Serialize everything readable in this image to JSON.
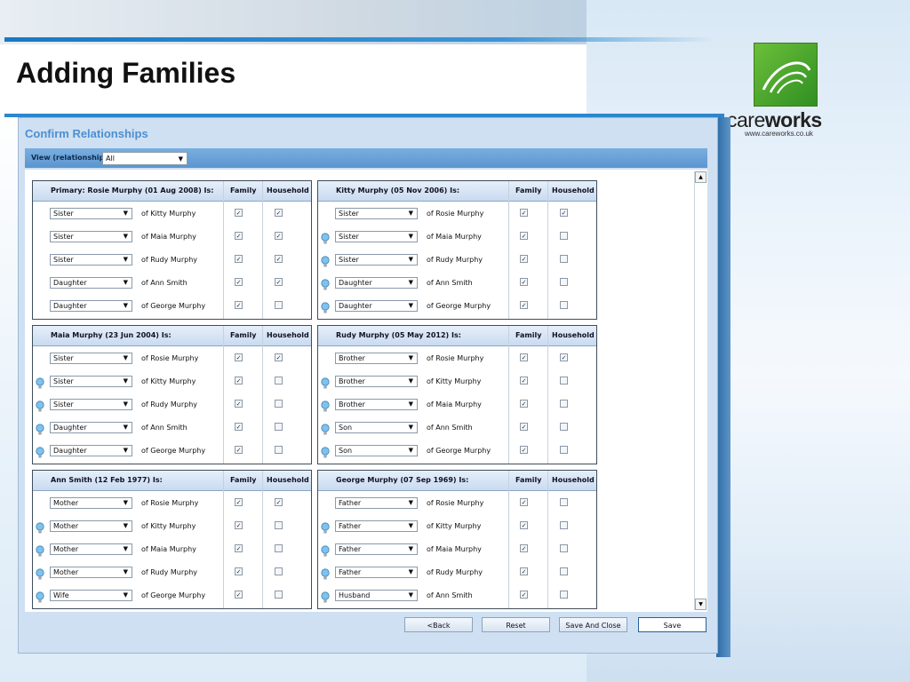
{
  "slide": {
    "title": "Adding Families",
    "brand_light": "care",
    "brand_bold": "works",
    "brand_url": "www.careworks.co.uk",
    "accent": "#2c87cc",
    "logo_color": "#4ea82a"
  },
  "dialog": {
    "title": "Confirm Relationships",
    "filter_label": "View (relationship)",
    "filter_value": "All"
  },
  "columns": {
    "family": "Family",
    "household": "Household"
  },
  "panels": [
    {
      "heading": "Primary: Rosie Murphy (01 Aug 2008) Is:",
      "rows": [
        {
          "rel": "Sister",
          "of": "of Kitty Murphy",
          "family": true,
          "household": true,
          "hint": false
        },
        {
          "rel": "Sister",
          "of": "of Maia Murphy",
          "family": true,
          "household": true,
          "hint": false
        },
        {
          "rel": "Sister",
          "of": "of Rudy Murphy",
          "family": true,
          "household": true,
          "hint": false
        },
        {
          "rel": "Daughter",
          "of": "of Ann Smith",
          "family": true,
          "household": true,
          "hint": false
        },
        {
          "rel": "Daughter",
          "of": "of George Murphy",
          "family": true,
          "household": false,
          "hint": false
        }
      ]
    },
    {
      "heading": "Kitty Murphy (05 Nov 2006) Is:",
      "rows": [
        {
          "rel": "Sister",
          "of": "of Rosie Murphy",
          "family": true,
          "household": true,
          "hint": false
        },
        {
          "rel": "Sister",
          "of": "of Maia Murphy",
          "family": true,
          "household": false,
          "hint": true
        },
        {
          "rel": "Sister",
          "of": "of Rudy Murphy",
          "family": true,
          "household": false,
          "hint": true
        },
        {
          "rel": "Daughter",
          "of": "of Ann Smith",
          "family": true,
          "household": false,
          "hint": true
        },
        {
          "rel": "Daughter",
          "of": "of George Murphy",
          "family": true,
          "household": false,
          "hint": true
        }
      ]
    },
    {
      "heading": "Maia Murphy (23 Jun 2004) Is:",
      "rows": [
        {
          "rel": "Sister",
          "of": "of Rosie Murphy",
          "family": true,
          "household": true,
          "hint": false
        },
        {
          "rel": "Sister",
          "of": "of Kitty Murphy",
          "family": true,
          "household": false,
          "hint": true
        },
        {
          "rel": "Sister",
          "of": "of Rudy Murphy",
          "family": true,
          "household": false,
          "hint": true
        },
        {
          "rel": "Daughter",
          "of": "of Ann Smith",
          "family": true,
          "household": false,
          "hint": true
        },
        {
          "rel": "Daughter",
          "of": "of George Murphy",
          "family": true,
          "household": false,
          "hint": true
        }
      ]
    },
    {
      "heading": "Rudy Murphy (05 May 2012) Is:",
      "rows": [
        {
          "rel": "Brother",
          "of": "of Rosie Murphy",
          "family": true,
          "household": true,
          "hint": false
        },
        {
          "rel": "Brother",
          "of": "of Kitty Murphy",
          "family": true,
          "household": false,
          "hint": true
        },
        {
          "rel": "Brother",
          "of": "of Maia Murphy",
          "family": true,
          "household": false,
          "hint": true
        },
        {
          "rel": "Son",
          "of": "of Ann Smith",
          "family": true,
          "household": false,
          "hint": true
        },
        {
          "rel": "Son",
          "of": "of George Murphy",
          "family": true,
          "household": false,
          "hint": true
        }
      ]
    },
    {
      "heading": "Ann Smith (12 Feb 1977) Is:",
      "rows": [
        {
          "rel": "Mother",
          "of": "of Rosie Murphy",
          "family": true,
          "household": true,
          "hint": false
        },
        {
          "rel": "Mother",
          "of": "of Kitty Murphy",
          "family": true,
          "household": false,
          "hint": true
        },
        {
          "rel": "Mother",
          "of": "of Maia Murphy",
          "family": true,
          "household": false,
          "hint": true
        },
        {
          "rel": "Mother",
          "of": "of Rudy Murphy",
          "family": true,
          "household": false,
          "hint": true
        },
        {
          "rel": "Wife",
          "of": "of George Murphy",
          "family": true,
          "household": false,
          "hint": true
        }
      ]
    },
    {
      "heading": "George Murphy (07 Sep 1969) Is:",
      "rows": [
        {
          "rel": "Father",
          "of": "of Rosie Murphy",
          "family": true,
          "household": false,
          "hint": false
        },
        {
          "rel": "Father",
          "of": "of Kitty Murphy",
          "family": true,
          "household": false,
          "hint": true
        },
        {
          "rel": "Father",
          "of": "of Maia Murphy",
          "family": true,
          "household": false,
          "hint": true
        },
        {
          "rel": "Father",
          "of": "of Rudy Murphy",
          "family": true,
          "household": false,
          "hint": true
        },
        {
          "rel": "Husband",
          "of": "of Ann Smith",
          "family": true,
          "household": false,
          "hint": true
        }
      ]
    }
  ],
  "buttons": {
    "back": "<Back",
    "reset": "Reset",
    "save_close": "Save And Close",
    "save": "Save"
  }
}
